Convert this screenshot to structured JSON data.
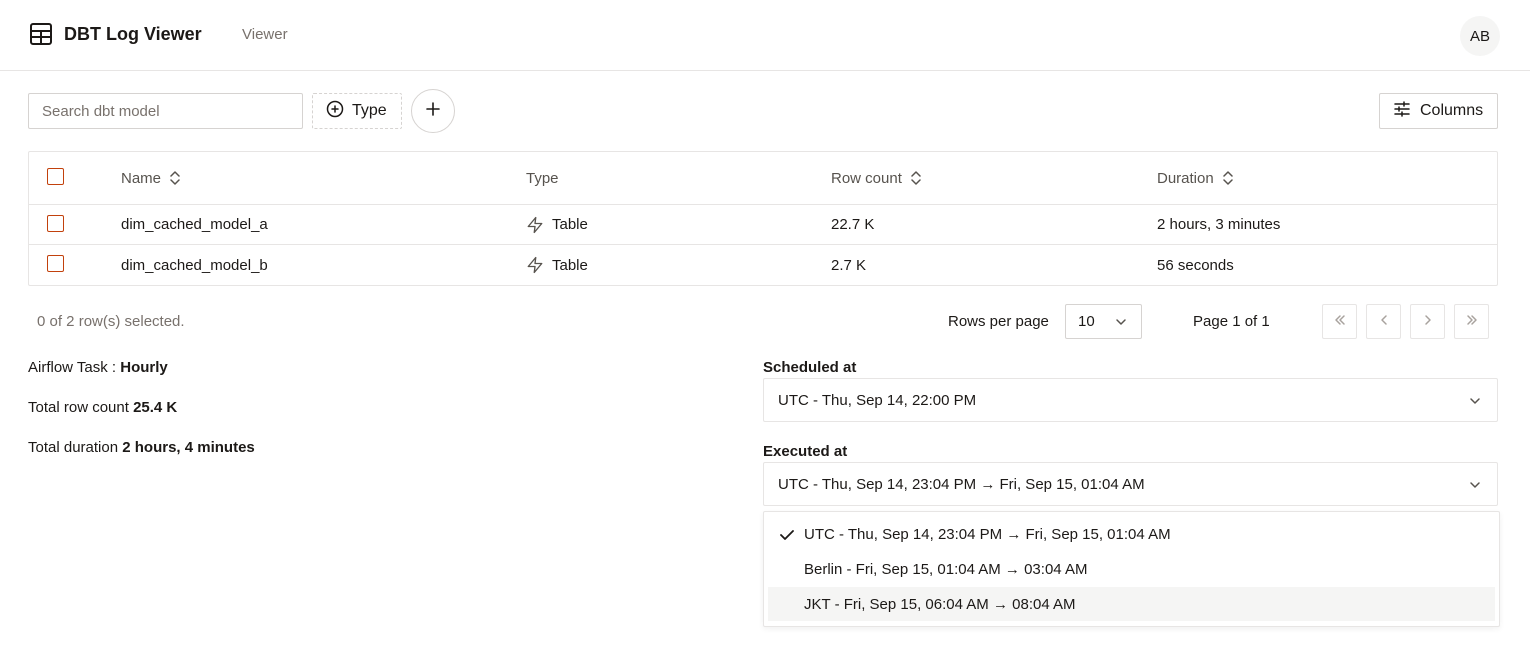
{
  "app": {
    "title": "DBT Log Viewer",
    "nav_item": "Viewer",
    "avatar_initials": "AB"
  },
  "toolbar": {
    "search_placeholder": "Search dbt model",
    "search_value": "",
    "type_filter_label": "Type",
    "columns_label": "Columns"
  },
  "table": {
    "headers": {
      "name": "Name",
      "type": "Type",
      "row_count": "Row count",
      "duration": "Duration"
    },
    "rows": [
      {
        "name": "dim_cached_model_a",
        "type": "Table",
        "row_count": "22.7 K",
        "duration": "2 hours, 3 minutes"
      },
      {
        "name": "dim_cached_model_b",
        "type": "Table",
        "row_count": "2.7 K",
        "duration": "56 seconds"
      }
    ]
  },
  "footer": {
    "selected_text": "0 of 2 row(s) selected.",
    "rows_per_page_label": "Rows per page",
    "rows_per_page_value": "10",
    "page_info": "Page 1 of 1"
  },
  "summary": {
    "airflow_label": "Airflow Task :",
    "airflow_value": "Hourly",
    "row_count_label": "Total row count",
    "row_count_value": "25.4 K",
    "duration_label": "Total duration",
    "duration_value": "2 hours, 4 minutes"
  },
  "scheduled": {
    "label": "Scheduled at",
    "value": "UTC - Thu, Sep 14, 22:00 PM"
  },
  "executed": {
    "label": "Executed at",
    "value": "UTC - Thu, Sep 14, 23:04 PM → Fri, Sep 15, 01:04 AM",
    "options": [
      {
        "label": "UTC - Thu, Sep 14, 23:04 PM → Fri, Sep 15, 01:04 AM",
        "selected": true
      },
      {
        "label": "Berlin - Fri, Sep 15, 01:04 AM → 03:04 AM",
        "selected": false
      },
      {
        "label": "JKT - Fri, Sep 15, 06:04 AM → 08:04 AM",
        "selected": false
      }
    ]
  },
  "colors": {
    "accent": "#c2410c",
    "text": "#1c1917",
    "muted": "#78716c",
    "border": "#e7e5e4",
    "hover": "#f5f5f4"
  }
}
